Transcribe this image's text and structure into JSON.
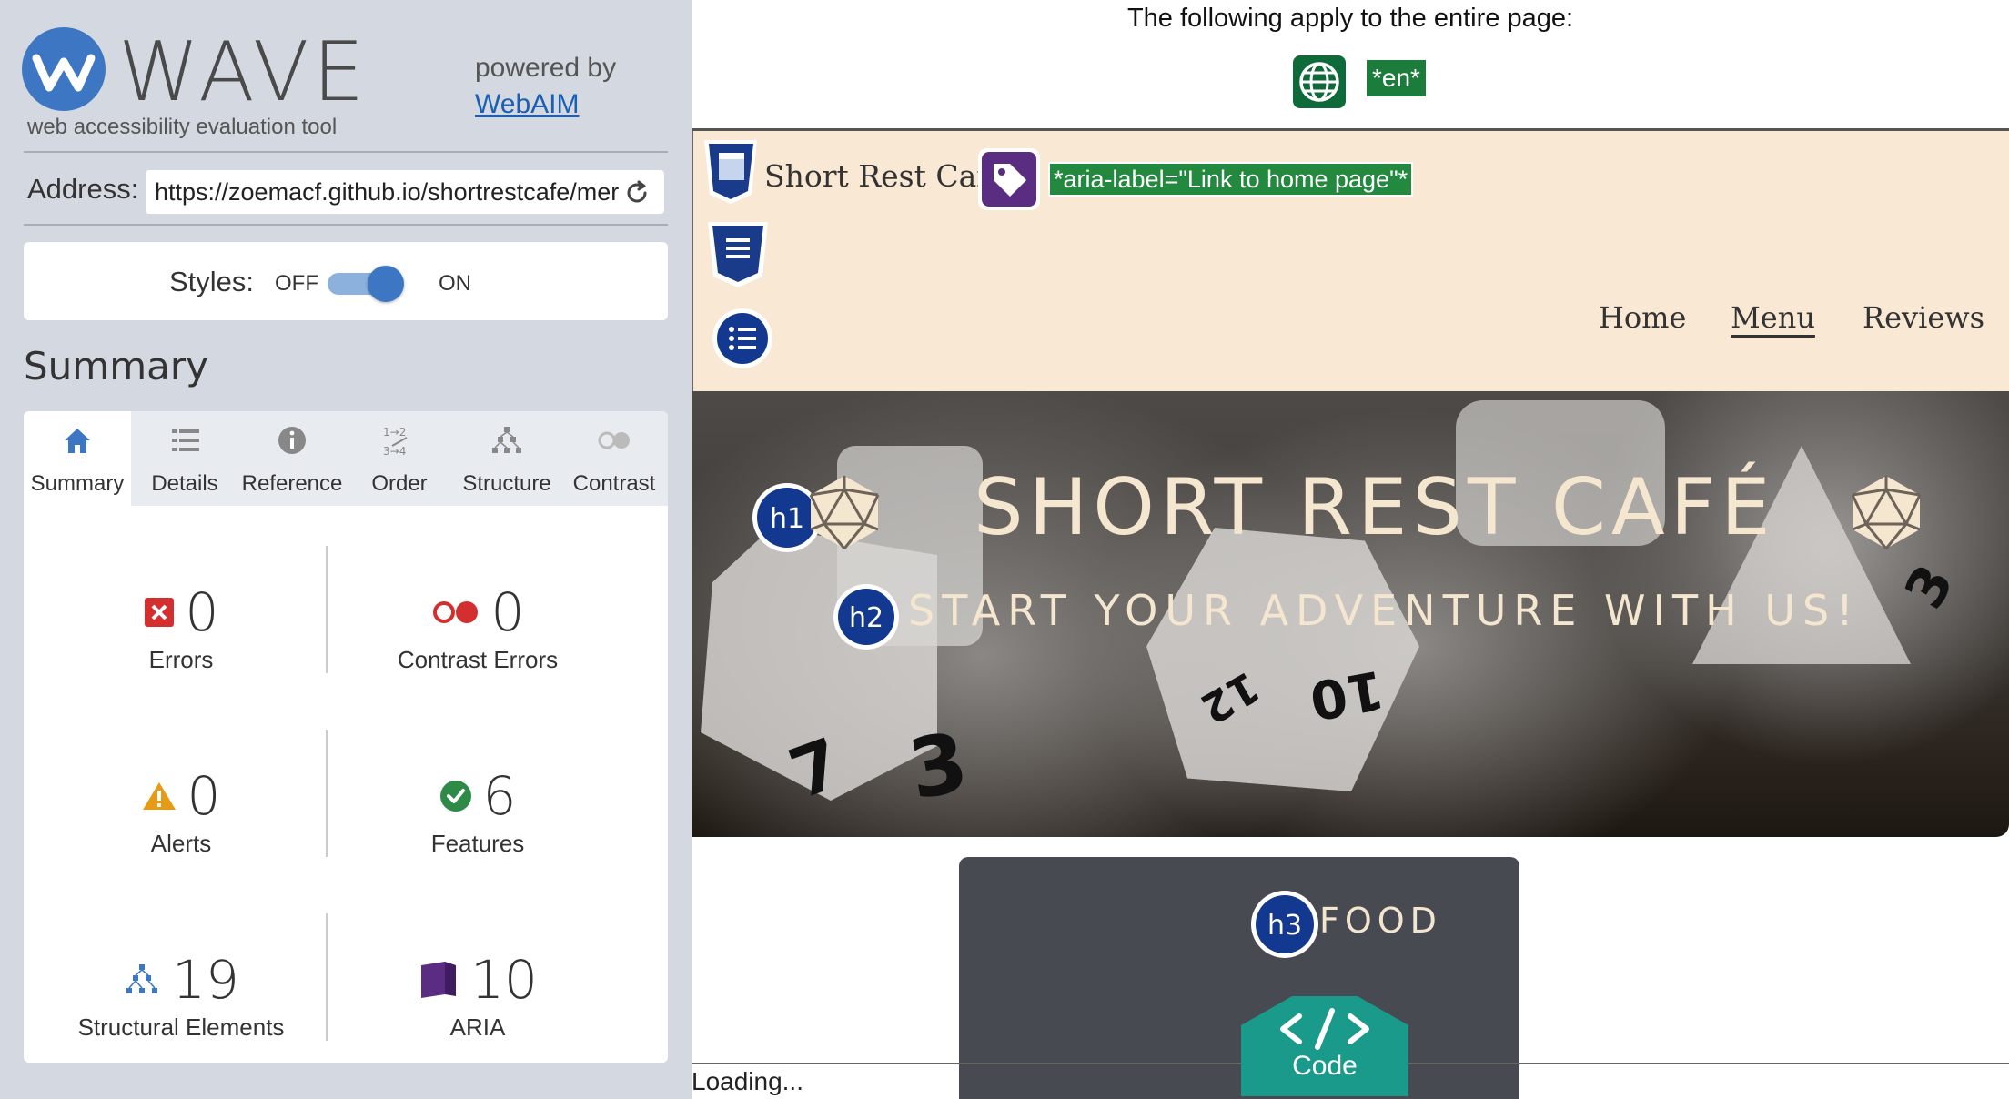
{
  "wave": {
    "title": "WAVE",
    "subtitle": "web accessibility evaluation tool",
    "powered_by": "powered by",
    "webaim_link": "WebAIM",
    "address_label": "Address:",
    "address_value": "https://zoemacf.github.io/shortrestcafe/mer",
    "styles_label": "Styles:",
    "styles_off": "OFF",
    "styles_on": "ON",
    "styles_enabled": true,
    "summary_heading": "Summary",
    "tabs": [
      {
        "label": "Summary",
        "icon": "home-icon",
        "active": true
      },
      {
        "label": "Details",
        "icon": "list-icon",
        "active": false
      },
      {
        "label": "Reference",
        "icon": "info-icon",
        "active": false
      },
      {
        "label": "Order",
        "icon": "order-icon",
        "active": false
      },
      {
        "label": "Structure",
        "icon": "structure-icon",
        "active": false
      },
      {
        "label": "Contrast",
        "icon": "contrast-icon",
        "active": false
      }
    ],
    "stats": {
      "errors": {
        "count": "0",
        "label": "Errors",
        "icon": "error-icon",
        "color": "#d32f2f"
      },
      "contrast_errors": {
        "count": "0",
        "label": "Contrast Errors",
        "icon": "contrast-error-icon",
        "color": "#d32f2f"
      },
      "alerts": {
        "count": "0",
        "label": "Alerts",
        "icon": "alert-icon",
        "color": "#e69a16"
      },
      "features": {
        "count": "6",
        "label": "Features",
        "icon": "feature-icon",
        "color": "#2e8b47"
      },
      "structural": {
        "count": "19",
        "label": "Structural Elements",
        "icon": "structure-icon",
        "color": "#3d77c4"
      },
      "aria": {
        "count": "10",
        "label": "ARIA",
        "icon": "aria-icon",
        "color": "#5a2d82"
      }
    }
  },
  "preview": {
    "page_doc_text": "The following apply to the entire page:",
    "lang_tag": "*en*",
    "site": {
      "logo_text": "Short Rest Cafe",
      "aria_label_tag": "*aria-label=\"Link to home page\"*",
      "nav": [
        "Home",
        "Menu",
        "Reviews"
      ],
      "active_nav": "Menu",
      "hero_h1": "SHORT REST CAFÉ",
      "hero_h2": "START YOUR ADVENTURE WITH US!",
      "h1_badge": "h1",
      "h2_badge": "h2",
      "h3_badge": "h3",
      "food_heading": "FOOD"
    },
    "code_button": "Code",
    "status": "Loading..."
  },
  "colors": {
    "panel_bg": "#d4d9e1",
    "accent_blue": "#3d77c4",
    "header_bg": "#f8e8d4",
    "card_bg": "#484a51",
    "code_teal": "#1a9a8a"
  }
}
